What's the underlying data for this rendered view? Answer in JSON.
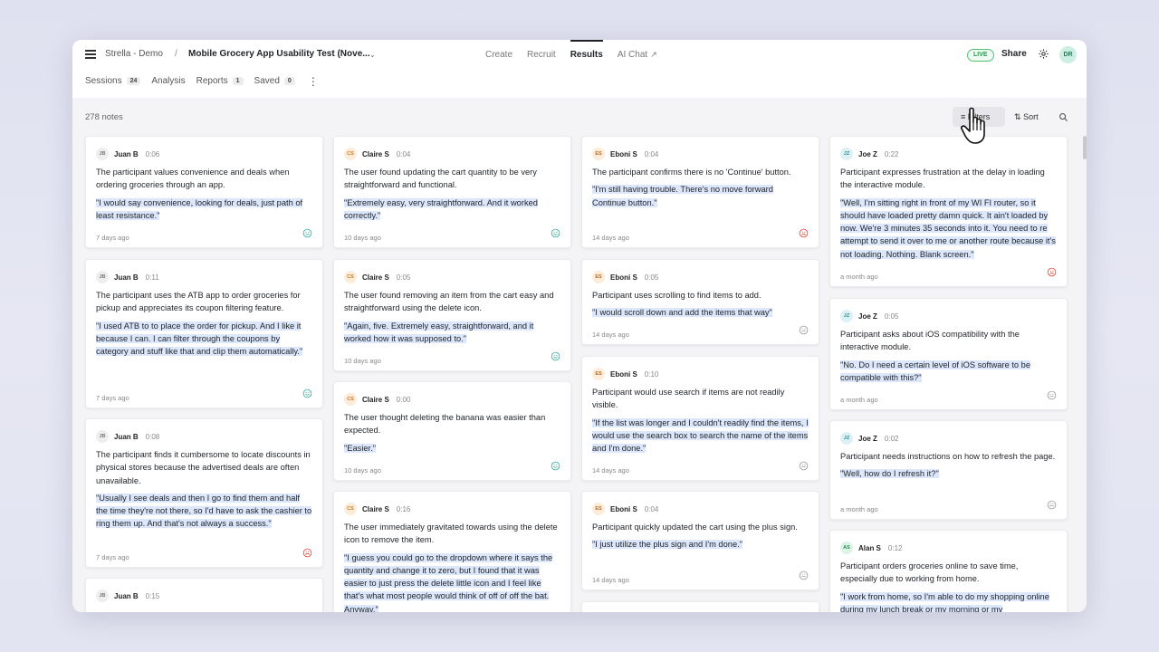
{
  "header": {
    "project": "Strella - Demo",
    "separator": "/",
    "study": "Mobile Grocery App Usability Test (Nove...",
    "nav": [
      {
        "label": "Create",
        "active": false
      },
      {
        "label": "Recruit",
        "active": false
      },
      {
        "label": "Results",
        "active": true
      },
      {
        "label": "AI Chat",
        "active": false
      }
    ],
    "live": "LIVE",
    "share": "Share",
    "user_initials": "DR"
  },
  "subtabs": [
    {
      "label": "Sessions",
      "count": "24"
    },
    {
      "label": "Analysis",
      "count": ""
    },
    {
      "label": "Reports",
      "count": "1"
    },
    {
      "label": "Saved",
      "count": "0"
    }
  ],
  "toolbar": {
    "notes_count": "278 notes",
    "filters": "Filters",
    "sort": "Sort"
  },
  "colors": {
    "positive": "#2fa8a0",
    "negative": "#e0453a",
    "neutral": "#9a9aa0",
    "quote_highlight": "#dce7fb"
  },
  "columns": [
    {
      "cards": [
        {
          "initials": "JB",
          "avatar": "jb",
          "name": "Juan B",
          "time": "0:06",
          "summary": "The participant values convenience and deals when ordering groceries through an app.",
          "quote": "\"I would say convenience, looking for deals, just path of least resistance.\"",
          "ago": "7 days ago",
          "sentiment": "positive"
        },
        {
          "initials": "JB",
          "avatar": "jb",
          "name": "Juan B",
          "time": "0:11",
          "summary": "The participant uses the ATB app to order groceries for pickup and appreciates its coupon filtering feature.",
          "quote": "\"I used ATB to to place the order for pickup. And I like it because I can. I can filter through the coupons by category and stuff like that and clip them automatically.\"",
          "ago": "7 days ago",
          "sentiment": "positive"
        },
        {
          "initials": "JB",
          "avatar": "jb",
          "name": "Juan B",
          "time": "0:08",
          "summary": "The participant finds it cumbersome to locate discounts in physical stores because the advertised deals are often unavailable.",
          "quote": "\"Usually I see deals and then I go to find them and half the time they're not there, so I'd have to ask the cashier to ring them up. And that's not always a success.\"",
          "ago": "7 days ago",
          "sentiment": "negative"
        },
        {
          "initials": "JB",
          "avatar": "jb",
          "name": "Juan B",
          "time": "0:15",
          "summary": "",
          "quote": "",
          "ago": "",
          "sentiment": ""
        }
      ]
    },
    {
      "cards": [
        {
          "initials": "CS",
          "avatar": "cs",
          "name": "Claire S",
          "time": "0:04",
          "summary": "The user found updating the cart quantity to be very straightforward and functional.",
          "quote": "\"Extremely easy, very straightforward. And it worked correctly.\"",
          "ago": "10 days ago",
          "sentiment": "positive"
        },
        {
          "initials": "CS",
          "avatar": "cs",
          "name": "Claire S",
          "time": "0:05",
          "summary": "The user found removing an item from the cart easy and straightforward using the delete icon.",
          "quote": "\"Again, five. Extremely easy, straightforward, and it worked how it was supposed to.\"",
          "ago": "10 days ago",
          "sentiment": "positive"
        },
        {
          "initials": "CS",
          "avatar": "cs",
          "name": "Claire S",
          "time": "0:00",
          "summary": "The user thought deleting the banana was easier than expected.",
          "quote": "\"Easier.\"",
          "ago": "10 days ago",
          "sentiment": "positive"
        },
        {
          "initials": "CS",
          "avatar": "cs",
          "name": "Claire S",
          "time": "0:16",
          "summary": "The user immediately gravitated towards using the delete icon to remove the item.",
          "quote": "\"I guess you could go to the dropdown where it says the quantity and change it to zero, but I found that it was easier to just press the delete little icon and I feel like that's what most people would think of off of off the bat. Anyway.\"",
          "ago": "",
          "sentiment": ""
        }
      ]
    },
    {
      "cards": [
        {
          "initials": "ES",
          "avatar": "es",
          "name": "Eboni S",
          "time": "0:04",
          "summary": "The participant confirms there is no 'Continue' button.",
          "quote": "\"I'm still having trouble. There's no move forward Continue button.\"",
          "ago": "14 days ago",
          "sentiment": "negative"
        },
        {
          "initials": "ES",
          "avatar": "es",
          "name": "Eboni S",
          "time": "0:05",
          "summary": "Participant uses scrolling to find items to add.",
          "quote": "\"I would scroll down and add the items that way\"",
          "ago": "14 days ago",
          "sentiment": "neutral"
        },
        {
          "initials": "ES",
          "avatar": "es",
          "name": "Eboni S",
          "time": "0:10",
          "summary": "Participant would use search if items are not readily visible.",
          "quote": "\"If the list was longer and I couldn't readily find the items, I would use the search box to search the name of the items and I'm done.\"",
          "ago": "14 days ago",
          "sentiment": "neutral"
        },
        {
          "initials": "ES",
          "avatar": "es",
          "name": "Eboni S",
          "time": "0:04",
          "summary": "Participant quickly updated the cart using the plus sign.",
          "quote": "\"I just utilize the plus sign and I'm done.\"",
          "ago": "14 days ago",
          "sentiment": "neutral"
        },
        {
          "initials": "",
          "avatar": "es",
          "name": "",
          "time": "",
          "summary": "",
          "quote": "",
          "ago": "",
          "sentiment": ""
        }
      ]
    },
    {
      "cards": [
        {
          "initials": "JZ",
          "avatar": "jz",
          "name": "Joe Z",
          "time": "0:22",
          "summary": "Participant expresses frustration at the delay in loading the interactive module.",
          "quote": "\"Well, I'm sitting right in front of my WI FI router, so it should have loaded pretty damn quick. It ain't loaded by now. We're 3 minutes 35 seconds into it. You need to re attempt to send it over to me or another route because it's not loading. Nothing. Blank screen.\"",
          "ago": "a month ago",
          "sentiment": "negative"
        },
        {
          "initials": "JZ",
          "avatar": "jz",
          "name": "Joe Z",
          "time": "0:05",
          "summary": "Participant asks about iOS compatibility with the interactive module.",
          "quote": "\"No. Do I need a certain level of iOS software to be compatible with this?\"",
          "ago": "a month ago",
          "sentiment": "neutral"
        },
        {
          "initials": "JZ",
          "avatar": "jz",
          "name": "Joe Z",
          "time": "0:02",
          "summary": "Participant needs instructions on how to refresh the page.",
          "quote": "\"Well, how do I refresh it?\"",
          "ago": "a month ago",
          "sentiment": "neutral"
        },
        {
          "initials": "AS",
          "avatar": "as",
          "name": "Alan S",
          "time": "0:12",
          "summary": "Participant orders groceries online to save time, especially due to working from home.",
          "quote": "\"I work from home, so I'm able to do my shopping online during my lunch break or my morning or my",
          "ago": "",
          "sentiment": ""
        }
      ]
    }
  ]
}
